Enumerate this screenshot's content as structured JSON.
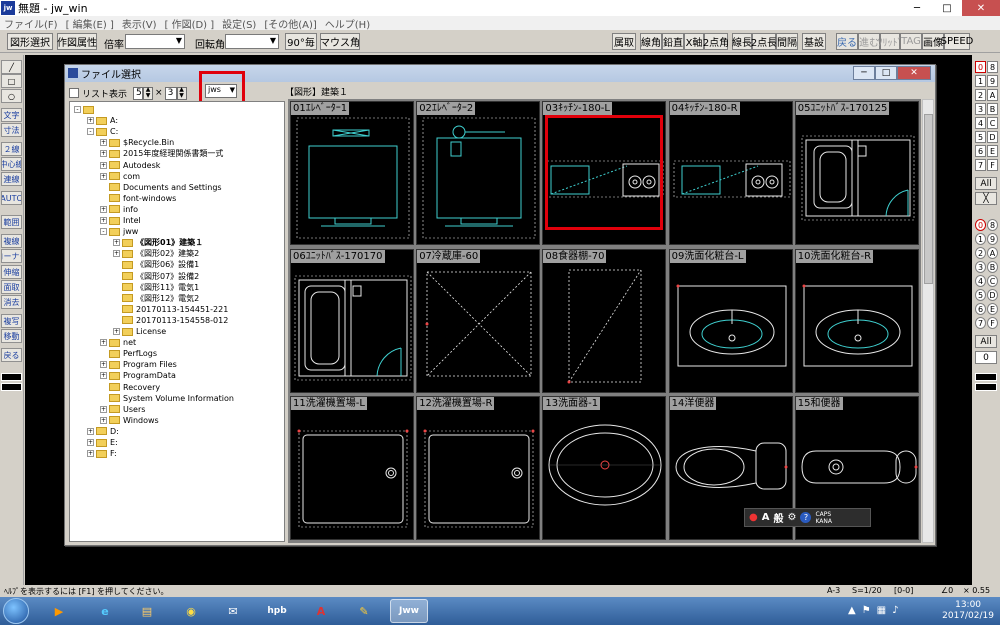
{
  "window": {
    "title": "無題 - jw_win",
    "logo": "jw"
  },
  "menu": [
    "ファイル(F)",
    "[ 編集(E) ]",
    "表示(V)",
    "[ 作図(D) ]",
    "設定(S)",
    "[その他(A)]",
    "ヘルプ(H)"
  ],
  "toolbar": {
    "select": "図形選択",
    "attr": "作図属性",
    "scale_label": "倍率",
    "angle_label": "回転角",
    "deg90": "90°毎",
    "mouse_angle": "マウス角",
    "right": [
      "属取",
      "線角",
      "鉛直",
      "X軸",
      "2点角",
      "線長",
      "2点長",
      "間隔",
      "基設"
    ],
    "far": [
      "戻る",
      "進む",
      "ｿﾘｯﾄﾞ",
      "TAG",
      "画像",
      "SPEED"
    ]
  },
  "lefttool": [
    "文字",
    "寸法",
    "２線",
    "中心線",
    "連線",
    "AUTO",
    "範囲",
    "複線",
    "コーナー",
    "伸縮",
    "面取",
    "消去",
    "複写",
    "移動",
    "戻る"
  ],
  "righttool": {
    "pairs": [
      [
        "0",
        "8"
      ],
      [
        "1",
        "9"
      ],
      [
        "2",
        "A"
      ],
      [
        "3",
        "B"
      ],
      [
        "4",
        "C"
      ],
      [
        "5",
        "D"
      ],
      [
        "6",
        "E"
      ],
      [
        "7",
        "F"
      ]
    ],
    "all": "All",
    "pairs2": [
      [
        "0",
        "8"
      ],
      [
        "1",
        "9"
      ],
      [
        "2",
        "A"
      ],
      [
        "3",
        "B"
      ],
      [
        "4",
        "C"
      ],
      [
        "5",
        "D"
      ],
      [
        "6",
        "E"
      ],
      [
        "7",
        "F"
      ]
    ],
    "all2": "All",
    "zero": "0"
  },
  "dialog": {
    "title": "ファイル選択",
    "list_view": "リスト表示",
    "cols": "5",
    "times": "×",
    "rows": "3",
    "ext": "jws",
    "path": "【図形】建築１"
  },
  "tree": [
    {
      "lvl": 0,
      "pm": "-",
      "name": ""
    },
    {
      "lvl": 1,
      "pm": "+",
      "name": "A:"
    },
    {
      "lvl": 1,
      "pm": "-",
      "name": "C:"
    },
    {
      "lvl": 2,
      "pm": "+",
      "name": "$Recycle.Bin"
    },
    {
      "lvl": 2,
      "pm": "+",
      "name": "2015年度経理関係書類一式"
    },
    {
      "lvl": 2,
      "pm": "+",
      "name": "Autodesk"
    },
    {
      "lvl": 2,
      "pm": "+",
      "name": "com"
    },
    {
      "lvl": 2,
      "pm": "",
      "name": "Documents and Settings"
    },
    {
      "lvl": 2,
      "pm": "",
      "name": "font-windows"
    },
    {
      "lvl": 2,
      "pm": "+",
      "name": "info"
    },
    {
      "lvl": 2,
      "pm": "+",
      "name": "Intel"
    },
    {
      "lvl": 2,
      "pm": "-",
      "name": "jww"
    },
    {
      "lvl": 3,
      "pm": "+",
      "name": "《図形01》建築１",
      "sel": true
    },
    {
      "lvl": 3,
      "pm": "+",
      "name": "《図形02》建築2"
    },
    {
      "lvl": 3,
      "pm": "",
      "name": "《図形06》設備1"
    },
    {
      "lvl": 3,
      "pm": "",
      "name": "《図形07》設備2"
    },
    {
      "lvl": 3,
      "pm": "",
      "name": "《図形11》電気1"
    },
    {
      "lvl": 3,
      "pm": "",
      "name": "《図形12》電気2"
    },
    {
      "lvl": 3,
      "pm": "",
      "name": "20170113-154451-221"
    },
    {
      "lvl": 3,
      "pm": "",
      "name": "20170113-154558-012"
    },
    {
      "lvl": 3,
      "pm": "+",
      "name": "License"
    },
    {
      "lvl": 2,
      "pm": "+",
      "name": "net"
    },
    {
      "lvl": 2,
      "pm": "",
      "name": "PerfLogs"
    },
    {
      "lvl": 2,
      "pm": "+",
      "name": "Program Files"
    },
    {
      "lvl": 2,
      "pm": "+",
      "name": "ProgramData"
    },
    {
      "lvl": 2,
      "pm": "",
      "name": "Recovery"
    },
    {
      "lvl": 2,
      "pm": "",
      "name": "System Volume Information"
    },
    {
      "lvl": 2,
      "pm": "+",
      "name": "Users"
    },
    {
      "lvl": 2,
      "pm": "+",
      "name": "Windows"
    },
    {
      "lvl": 1,
      "pm": "+",
      "name": "D:"
    },
    {
      "lvl": 1,
      "pm": "+",
      "name": "E:"
    },
    {
      "lvl": 1,
      "pm": "+",
      "name": "F:"
    }
  ],
  "cells": [
    {
      "label": "01ｴﾚﾍﾞｰﾀｰ1",
      "kind": "elev1"
    },
    {
      "label": "02ｴﾚﾍﾞｰﾀｰ2",
      "kind": "elev2"
    },
    {
      "label": "03ｷｯﾁﾝ-180-L",
      "kind": "kitchenL"
    },
    {
      "label": "04ｷｯﾁﾝ-180-R",
      "kind": "kitchenR"
    },
    {
      "label": "05ﾕﾆｯﾄﾊﾞｽ-170125",
      "kind": "bath"
    },
    {
      "label": "06ﾕﾆｯﾄﾊﾞｽ-170170",
      "kind": "bath2"
    },
    {
      "label": "07冷蔵庫-60",
      "kind": "fridge"
    },
    {
      "label": "08食器棚-70",
      "kind": "cupboard"
    },
    {
      "label": "09洗面化粧台-L",
      "kind": "vanity"
    },
    {
      "label": "10洗面化粧台-R",
      "kind": "vanity"
    },
    {
      "label": "11洗濯機置場-L",
      "kind": "washer"
    },
    {
      "label": "12洗濯機置場-R",
      "kind": "washer"
    },
    {
      "label": "13洗面器-1",
      "kind": "basin"
    },
    {
      "label": "14洋便器",
      "kind": "toilet"
    },
    {
      "label": "15和便器",
      "kind": "jtoilet"
    }
  ],
  "ime": {
    "mode": "A",
    "kanji": "般",
    "caps": "CAPS",
    "kana": "KANA"
  },
  "status": {
    "help": "ﾍﾙﾌﾟを表示するには [F1] を押してください。",
    "paper": "A-3",
    "scale": "S=1/20",
    "layer": "[0-0]",
    "angle": "∠0",
    "ratio": "× 0.55"
  },
  "taskbar": {
    "time": "13:00",
    "date": "2017/02/19",
    "apps": [
      "IE",
      "Explorer",
      "Chrome",
      "Mail",
      "hpb",
      "Acrobat",
      "Paint",
      "Jww"
    ]
  }
}
